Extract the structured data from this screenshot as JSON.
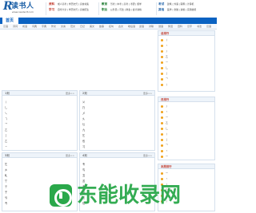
{
  "header": {
    "logo_mark": "R",
    "logo_text": "读书人",
    "logo_url": "www.readerif.com",
    "groups": [
      {
        "label": "资料",
        "color": "#c0392b",
        "row1": "成人高考 | 学历文凭 | 高校书集",
        "row2_label": "学习",
        "row2": "自考大全 | 学历文凭 | 高校招生"
      },
      {
        "label": "教育",
        "color": "#1b7a2e",
        "row1": "驾考 | 中考 | 高考 | 考研 | 留学",
        "row2_label": "职业",
        "row2": "公务员 | 司法 | 财会 | 会计资格"
      },
      {
        "label": "考试",
        "color": "#1b5fa6",
        "row1": "建筑 | 外语 | 职称 | 计算机",
        "row2_label": "其他",
        "row2": "医学 | 金融 | 资格 | 实用技能"
      }
    ]
  },
  "nav": {
    "active": "首页",
    "color": "#0a62c2"
  },
  "subnav": [
    "汉语",
    "诗词",
    "成语",
    "词典",
    "字典",
    "作文",
    "文言",
    "范文",
    "日记",
    "美文",
    "故事",
    "名句",
    "古文",
    "歇后语",
    "谚语",
    "对联",
    "谜语",
    "笑话",
    "百科",
    "汉字",
    "书法",
    "汉语"
  ],
  "sidebar": {
    "boxes": [
      {
        "title": "总排行",
        "items": [
          "丨",
          "丶",
          "丿",
          "乙",
          "一",
          "乚",
          "亅",
          "乛",
          "丨",
          "丿"
        ]
      },
      {
        "title": "月排行",
        "items": [
          "丿",
          "丶",
          "一",
          "乙",
          "乚",
          "丨",
          "亅",
          "乛",
          "丶",
          "一"
        ]
      },
      {
        "title": "本周排行",
        "items": [
          "一",
          "丶",
          "丨",
          "乙",
          "乚",
          "丿",
          "乛",
          "亅"
        ]
      }
    ]
  },
  "main": {
    "boxes": [
      {
        "title": "1划",
        "more": "更多>>",
        "items": [
          "丨",
          "乚",
          "乀",
          "乁",
          "乛",
          "乙",
          "亅",
          "乙",
          "㇀"
        ]
      },
      {
        "title": "2划",
        "more": "更多>>",
        "items": [
          "乂",
          "乃",
          "乄",
          "乆",
          "乜",
          "九",
          "乞",
          "也",
          "习"
        ]
      },
      {
        "title": "3划",
        "more": "更多>>",
        "items": [
          "乞",
          "乡",
          "乢",
          "亇",
          "亍",
          "于",
          "亏",
          "亐",
          "亡"
        ]
      },
      {
        "title": "4划",
        "more": "更多>>",
        "items": [
          "专",
          "丐",
          "丑",
          "丒",
          "专",
          "且",
          "丕",
          "世",
          "丗"
        ]
      }
    ]
  },
  "watermark": {
    "text": "东能收录网",
    "color": "#2aa84a"
  }
}
